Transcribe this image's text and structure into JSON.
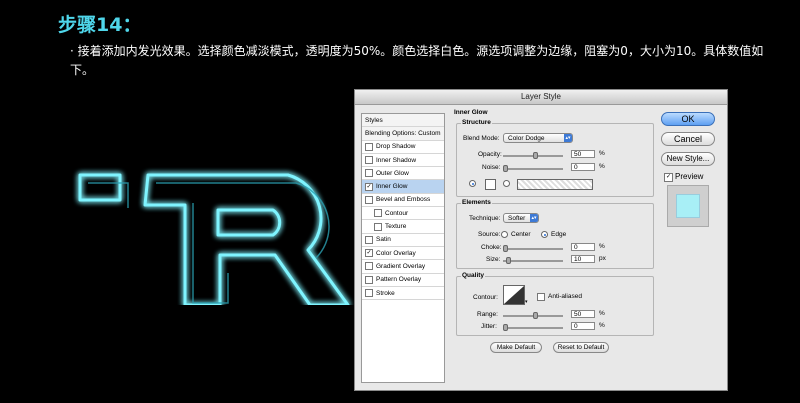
{
  "step_title": "步骤14：",
  "description": "· 接着添加内发光效果。选择颜色减淡模式，透明度为50%。颜色选择白色。源选项调整为边缘，阻塞为0，大小为10。具体数值如下。",
  "dialog": {
    "title": "Layer Style",
    "styles_header": "Styles",
    "blending_options": "Blending Options: Custom",
    "style_items": [
      {
        "label": "Drop Shadow",
        "checked": false
      },
      {
        "label": "Inner Shadow",
        "checked": false
      },
      {
        "label": "Outer Glow",
        "checked": false
      },
      {
        "label": "Inner Glow",
        "checked": true
      },
      {
        "label": "Bevel and Emboss",
        "checked": false
      },
      {
        "label": "Contour",
        "checked": false
      },
      {
        "label": "Texture",
        "checked": false
      },
      {
        "label": "Satin",
        "checked": false
      },
      {
        "label": "Color Overlay",
        "checked": true
      },
      {
        "label": "Gradient Overlay",
        "checked": false
      },
      {
        "label": "Pattern Overlay",
        "checked": false
      },
      {
        "label": "Stroke",
        "checked": false
      }
    ],
    "panel_title": "Inner Glow",
    "structure": {
      "title": "Structure",
      "blend_mode_label": "Blend Mode:",
      "blend_mode_value": "Color Dodge",
      "opacity_label": "Opacity:",
      "opacity_value": "50",
      "noise_label": "Noise:",
      "noise_value": "0",
      "pct": "%"
    },
    "elements": {
      "title": "Elements",
      "technique_label": "Technique:",
      "technique_value": "Softer",
      "source_label": "Source:",
      "source_center": "Center",
      "source_edge": "Edge",
      "choke_label": "Choke:",
      "choke_value": "0",
      "size_label": "Size:",
      "size_value": "10",
      "px": "px"
    },
    "quality": {
      "title": "Quality",
      "contour_label": "Contour:",
      "anti_aliased": "Anti-aliased",
      "range_label": "Range:",
      "range_value": "50",
      "jitter_label": "Jitter:",
      "jitter_value": "0"
    },
    "make_default": "Make Default",
    "reset_default": "Reset to Default",
    "ok": "OK",
    "cancel": "Cancel",
    "new_style": "New Style...",
    "preview": "Preview"
  }
}
